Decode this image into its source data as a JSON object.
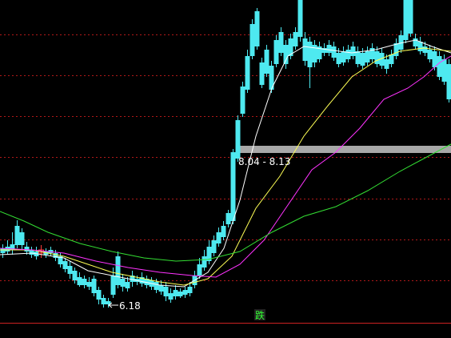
{
  "chart_data": {
    "type": "candlestick",
    "price_low_label": "6.18",
    "gap_zone": {
      "low": 8.04,
      "high": 8.13,
      "label": "8.04 - 8.13"
    },
    "signal_label": "跌",
    "colors": {
      "background": "#000000",
      "up": "#ff3b3b",
      "down": "#4ee9f0",
      "ma_short": "#ffffff",
      "ma_mid": "#ffff55",
      "ma_long": "#ff33ff",
      "ma_longest": "#33dd33",
      "grid": "#b01818",
      "gap_band": "#a8a8a8",
      "label_text": "#ffffff",
      "signal_text": "#33ff33",
      "signal_bg": "#222222",
      "bottom_line": "#cc2222"
    }
  }
}
